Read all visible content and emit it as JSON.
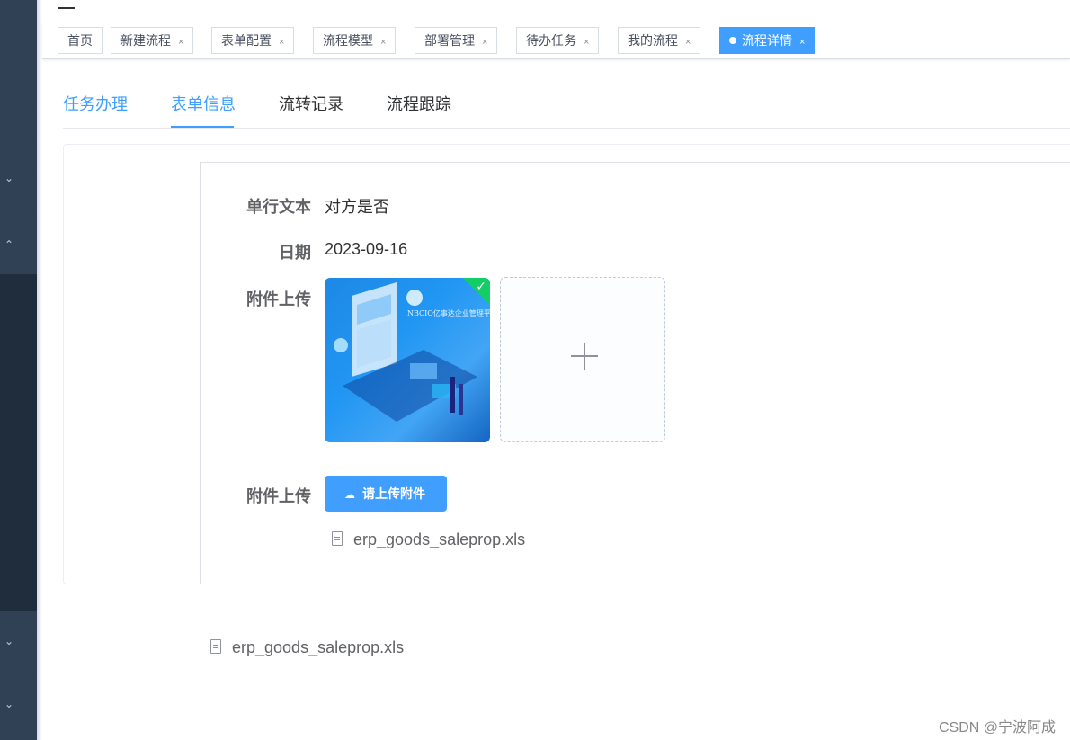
{
  "tags": [
    {
      "label": "首页",
      "closable": false,
      "active": false
    },
    {
      "label": "新建流程",
      "closable": true,
      "active": false
    },
    {
      "label": "表单配置",
      "closable": true,
      "active": false
    },
    {
      "label": "流程模型",
      "closable": true,
      "active": false
    },
    {
      "label": "部署管理",
      "closable": true,
      "active": false
    },
    {
      "label": "待办任务",
      "closable": true,
      "active": false
    },
    {
      "label": "我的流程",
      "closable": true,
      "active": false
    },
    {
      "label": "流程详情",
      "closable": true,
      "active": true
    }
  ],
  "close_glyph": "×",
  "tabs": [
    {
      "label": "任务办理"
    },
    {
      "label": "表单信息",
      "active": true
    },
    {
      "label": "流转记录"
    },
    {
      "label": "流程跟踪"
    }
  ],
  "form": {
    "text_label": "单行文本",
    "text_value": "对方是否",
    "date_label": "日期",
    "date_value": "2023-09-16",
    "image_upload_label": "附件上传",
    "image_overlay_text": "NBCIO亿事达企业管理平台",
    "file_upload_label": "附件上传",
    "upload_button": "请上传附件",
    "file_name": "erp_goods_saleprop.xls"
  },
  "bottom_file_name": "erp_goods_saleprop.xls",
  "watermark": "CSDN @宁波阿成",
  "colors": {
    "accent": "#409eff",
    "success": "#13ce66",
    "sidebar": "#304156"
  }
}
